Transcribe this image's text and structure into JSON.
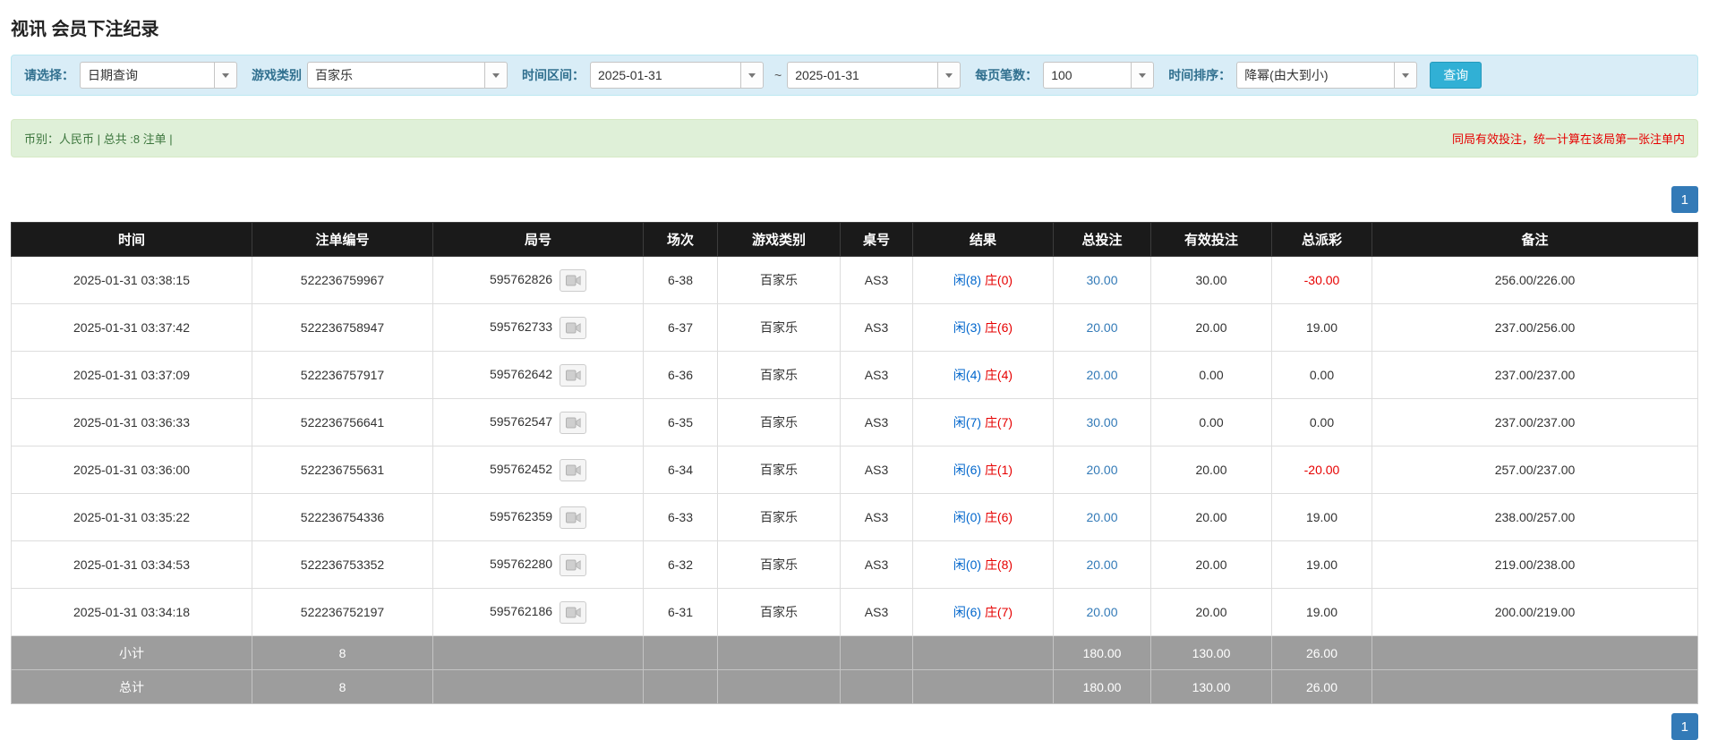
{
  "page": {
    "title": "视讯 会员下注纪录"
  },
  "filters": {
    "select_label": "请选择：",
    "select_value": "日期查询",
    "game_label": "游戏类别",
    "game_value": "百家乐",
    "range_label": "时间区间：",
    "date_from": "2025-01-31",
    "range_sep": "~",
    "date_to": "2025-01-31",
    "page_size_label": "每页笔数：",
    "page_size_value": "100",
    "sort_label": "时间排序：",
    "sort_value": "降幂(由大到小)",
    "search_label": "查询"
  },
  "notice": {
    "left": "币别：人民币 | 总共 :8 注单 |",
    "right": "同局有效投注，统一计算在该局第一张注单内"
  },
  "pagination": {
    "current_page": "1"
  },
  "table": {
    "headers": [
      "时间",
      "注单编号",
      "局号",
      "场次",
      "游戏类别",
      "桌号",
      "结果",
      "总投注",
      "有效投注",
      "总派彩",
      "备注"
    ],
    "rows": [
      {
        "time": "2025-01-31 03:38:15",
        "bet_id": "522236759967",
        "round_id": "595762826",
        "session": "6-38",
        "game": "百家乐",
        "table_no": "AS3",
        "player": "闲(8)",
        "banker": "庄(0)",
        "total_bet": "30.00",
        "valid_bet": "30.00",
        "payout": "-30.00",
        "note": "256.00/226.00"
      },
      {
        "time": "2025-01-31 03:37:42",
        "bet_id": "522236758947",
        "round_id": "595762733",
        "session": "6-37",
        "game": "百家乐",
        "table_no": "AS3",
        "player": "闲(3)",
        "banker": "庄(6)",
        "total_bet": "20.00",
        "valid_bet": "20.00",
        "payout": "19.00",
        "note": "237.00/256.00"
      },
      {
        "time": "2025-01-31 03:37:09",
        "bet_id": "522236757917",
        "round_id": "595762642",
        "session": "6-36",
        "game": "百家乐",
        "table_no": "AS3",
        "player": "闲(4)",
        "banker": "庄(4)",
        "total_bet": "20.00",
        "valid_bet": "0.00",
        "payout": "0.00",
        "note": "237.00/237.00"
      },
      {
        "time": "2025-01-31 03:36:33",
        "bet_id": "522236756641",
        "round_id": "595762547",
        "session": "6-35",
        "game": "百家乐",
        "table_no": "AS3",
        "player": "闲(7)",
        "banker": "庄(7)",
        "total_bet": "30.00",
        "valid_bet": "0.00",
        "payout": "0.00",
        "note": "237.00/237.00"
      },
      {
        "time": "2025-01-31 03:36:00",
        "bet_id": "522236755631",
        "round_id": "595762452",
        "session": "6-34",
        "game": "百家乐",
        "table_no": "AS3",
        "player": "闲(6)",
        "banker": "庄(1)",
        "total_bet": "20.00",
        "valid_bet": "20.00",
        "payout": "-20.00",
        "note": "257.00/237.00"
      },
      {
        "time": "2025-01-31 03:35:22",
        "bet_id": "522236754336",
        "round_id": "595762359",
        "session": "6-33",
        "game": "百家乐",
        "table_no": "AS3",
        "player": "闲(0)",
        "banker": "庄(6)",
        "total_bet": "20.00",
        "valid_bet": "20.00",
        "payout": "19.00",
        "note": "238.00/257.00"
      },
      {
        "time": "2025-01-31 03:34:53",
        "bet_id": "522236753352",
        "round_id": "595762280",
        "session": "6-32",
        "game": "百家乐",
        "table_no": "AS3",
        "player": "闲(0)",
        "banker": "庄(8)",
        "total_bet": "20.00",
        "valid_bet": "20.00",
        "payout": "19.00",
        "note": "219.00/238.00"
      },
      {
        "time": "2025-01-31 03:34:18",
        "bet_id": "522236752197",
        "round_id": "595762186",
        "session": "6-31",
        "game": "百家乐",
        "table_no": "AS3",
        "player": "闲(6)",
        "banker": "庄(7)",
        "total_bet": "20.00",
        "valid_bet": "20.00",
        "payout": "19.00",
        "note": "200.00/219.00"
      }
    ],
    "subtotal": {
      "label": "小计",
      "bet_count": "8",
      "total_bet": "180.00",
      "valid_bet": "130.00",
      "payout": "26.00"
    },
    "total": {
      "label": "总计",
      "bet_count": "8",
      "total_bet": "180.00",
      "valid_bet": "130.00",
      "payout": "26.00"
    }
  },
  "colors": {
    "player": "#0066cc",
    "banker": "#e60000",
    "bet_link": "#337ab7",
    "negative": "#e60000",
    "pagination": "#337ab7",
    "search_button": "#31b0d5"
  }
}
